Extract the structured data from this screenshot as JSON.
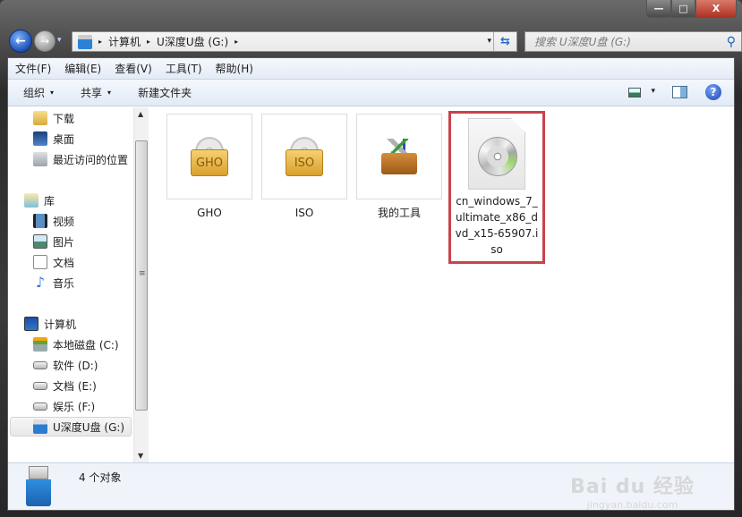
{
  "window": {
    "controls": {
      "minimize": "—",
      "maximize": "□",
      "close": "X"
    }
  },
  "nav": {
    "back_icon": "←",
    "forward_icon": "→",
    "history_icon": "▾",
    "address": {
      "icon": "usb-drive-icon",
      "breadcrumbs": [
        "计算机",
        "U深度U盘 (G:)"
      ],
      "separator": "▸",
      "dropdown_icon": "▾",
      "refresh_icon": "⇆"
    },
    "search": {
      "placeholder": "搜索 U深度U盘 (G:)",
      "icon": "⚲"
    }
  },
  "menubar": {
    "items": [
      "文件(F)",
      "编辑(E)",
      "查看(V)",
      "工具(T)",
      "帮助(H)"
    ]
  },
  "toolbar": {
    "organize": "组织",
    "share": "共享",
    "new_folder": "新建文件夹",
    "caret": "▾",
    "help": "?"
  },
  "sidebar": {
    "items": [
      {
        "label": "下载",
        "icon": "downloads-folder-icon"
      },
      {
        "label": "桌面",
        "icon": "desktop-icon"
      },
      {
        "label": "最近访问的位置",
        "icon": "recent-places-icon"
      },
      {
        "label": "库",
        "icon": "libraries-icon"
      },
      {
        "label": "视频",
        "icon": "videos-icon"
      },
      {
        "label": "图片",
        "icon": "pictures-icon"
      },
      {
        "label": "文档",
        "icon": "documents-icon"
      },
      {
        "label": "音乐",
        "icon": "music-icon"
      },
      {
        "label": "计算机",
        "icon": "computer-icon"
      },
      {
        "label": "本地磁盘 (C:)",
        "icon": "system-drive-icon"
      },
      {
        "label": "软件 (D:)",
        "icon": "drive-icon"
      },
      {
        "label": "文档 (E:)",
        "icon": "drive-icon"
      },
      {
        "label": "娱乐 (F:)",
        "icon": "drive-icon"
      },
      {
        "label": "U深度U盘 (G:)",
        "icon": "usb-drive-icon",
        "selected": true
      }
    ],
    "music_glyph": "♪",
    "scroll_up": "▲",
    "scroll_down": "▼",
    "grip": "≡"
  },
  "files": [
    {
      "name": "GHO",
      "type": "folder",
      "badge": "GHO"
    },
    {
      "name": "ISO",
      "type": "folder",
      "badge": "ISO"
    },
    {
      "name": "我的工具",
      "type": "folder"
    },
    {
      "name": "cn_windows_7_ultimate_x86_dvd_x15-65907.iso",
      "type": "iso",
      "highlighted": true
    }
  ],
  "status": {
    "count_text": "4 个对象"
  },
  "watermark": {
    "main": "Bai du 经验",
    "sub": "jingyan.baidu.com"
  },
  "colors": {
    "highlight_border": "#c9424c",
    "close_button": "#b03324"
  }
}
